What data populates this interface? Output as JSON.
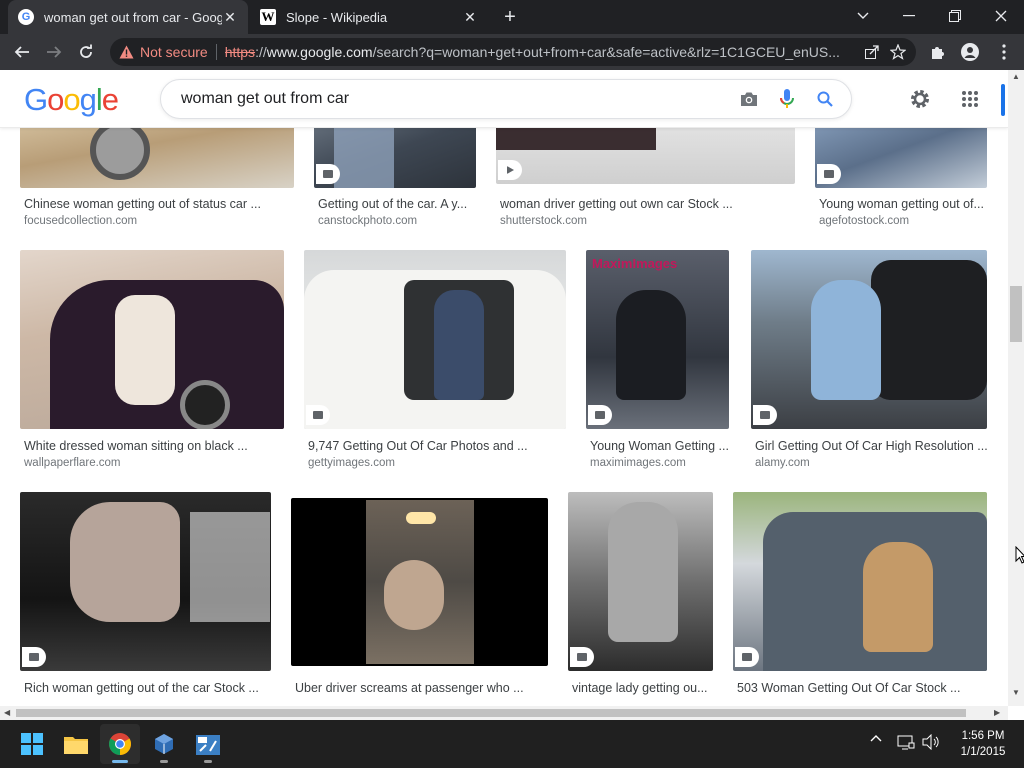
{
  "tabs": [
    {
      "title": "woman get out from car - Google",
      "favicon": "G",
      "active": true
    },
    {
      "title": "Slope - Wikipedia",
      "favicon": "W",
      "active": false
    }
  ],
  "toolbar": {
    "security_label": "Not secure",
    "url_scheme": "https",
    "url_sep": "://",
    "url_host": "www.google.com",
    "url_rest": "/search?q=woman+get+out+from+car&safe=active&rlz=1C1GCEU_enUS..."
  },
  "header": {
    "logo_letters": [
      "G",
      "o",
      "o",
      "g",
      "l",
      "e"
    ],
    "logo_colors": [
      "#4285F4",
      "#EA4335",
      "#FBBC05",
      "#4285F4",
      "#34A853",
      "#EA4335"
    ],
    "query": "woman get out from car"
  },
  "rows": [
    {
      "row": "top-partial",
      "items": [
        {
          "title": "Chinese woman getting out of status car ...",
          "source": "focusedcollection.com",
          "badge": "image"
        },
        {
          "title": "Getting out of the car. A y...",
          "source": "canstockphoto.com",
          "badge": "image"
        },
        {
          "title": "woman driver getting out own car Stock ...",
          "source": "shutterstock.com",
          "badge": "video"
        },
        {
          "title": "Young woman getting out of...",
          "source": "agefotostock.com",
          "badge": "image"
        }
      ]
    },
    {
      "row": "middle",
      "items": [
        {
          "title": "White dressed woman sitting on black ...",
          "source": "wallpaperflare.com",
          "badge": "image"
        },
        {
          "title": "9,747 Getting Out Of Car Photos and ...",
          "source": "gettyimages.com",
          "badge": "image"
        },
        {
          "title": "Young Woman Getting ...",
          "source": "maximimages.com",
          "badge": "image",
          "watermark": "MaximImages"
        },
        {
          "title": "Girl Getting Out Of Car High Resolution ...",
          "source": "alamy.com",
          "badge": "image"
        }
      ]
    },
    {
      "row": "bottom",
      "items": [
        {
          "title": "Rich woman getting out of the car Stock ...",
          "source": "",
          "badge": "image"
        },
        {
          "title": "Uber driver screams at passenger who ...",
          "source": "",
          "badge": "none"
        },
        {
          "title": "vintage lady getting ou...",
          "source": "",
          "badge": "image"
        },
        {
          "title": "503 Woman Getting Out Of Car Stock ...",
          "source": "",
          "badge": "image"
        }
      ]
    }
  ],
  "taskbar": {
    "apps": [
      "windows-start",
      "file-explorer",
      "chrome",
      "virtualbox",
      "calculator-app"
    ],
    "time": "1:56 PM",
    "date": "1/1/2015"
  },
  "colors": {
    "chrome_dark": "#202124",
    "chrome_toolbar": "#35363a",
    "google_blue": "#1a73e8",
    "warn_red": "#f28b82"
  }
}
